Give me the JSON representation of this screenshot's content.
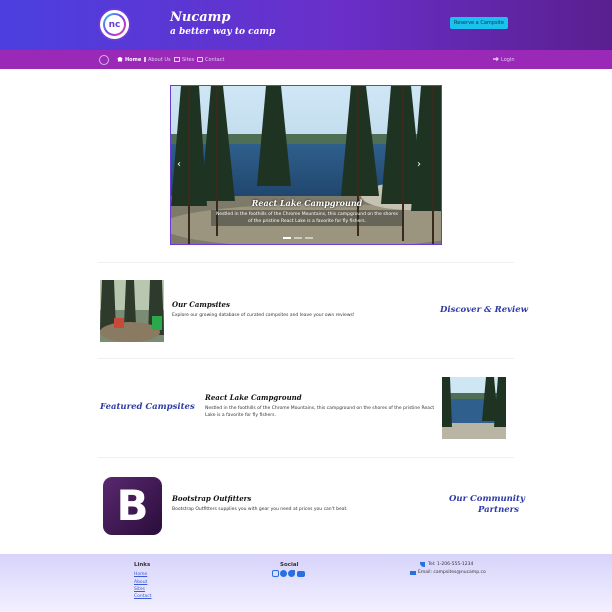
{
  "header": {
    "title": "Nucamp",
    "subtitle": "a better way to camp",
    "reserve_label": "Reserve a Campsite"
  },
  "nav": {
    "items": [
      {
        "label": "Home",
        "icon": "home-icon",
        "active": true
      },
      {
        "label": "About Us",
        "icon": "info-icon",
        "active": false
      },
      {
        "label": "Sites",
        "icon": "list-icon",
        "active": false
      },
      {
        "label": "Contact",
        "icon": "address-card-icon",
        "active": false
      }
    ],
    "login_label": "Login"
  },
  "carousel": {
    "title": "React Lake Campground",
    "text": "Nestled in the foothills of the Chrome Mountains, this campground on the shores of the pristine React Lake is a favorite for fly fishers.",
    "slides": 3,
    "active_slide": 1
  },
  "rows": [
    {
      "title": "Our Campsites",
      "text": "Explore our growing database of curated campsites and leave your own reviews!",
      "section_label": "Discover & Review"
    },
    {
      "title": "React Lake Campground",
      "text": "Nestled in the foothills of the Chrome Mountains, this campground on the shores of the pristine React Lake is a favorite for fly fishers.",
      "section_label": "Featured Campsites"
    },
    {
      "title": "Bootstrap Outfitters",
      "text": "Bootstrap Outfitters supplies you with gear you need at prices you can't beat.",
      "section_label_1": "Our Community",
      "section_label_2": "Partners",
      "logo_letter": "B"
    }
  ],
  "footer": {
    "links_heading": "Links",
    "links": [
      "Home",
      "About",
      "Sites",
      "Contact"
    ],
    "social_heading": "Social",
    "social_icons": [
      "instagram-icon",
      "facebook-icon",
      "twitter-icon",
      "youtube-icon"
    ],
    "phone": "Tel: 1-206-555-1234",
    "email": "Email: campsites@nucamp.co"
  },
  "colors": {
    "header_gradient_start": "#4b3fe0",
    "header_gradient_end": "#5a1f8f",
    "nav_bg": "#9a29b8",
    "accent": "#19c3ee",
    "section_label": "#2c3aa8",
    "footer_bg": "#d7d3fb"
  }
}
